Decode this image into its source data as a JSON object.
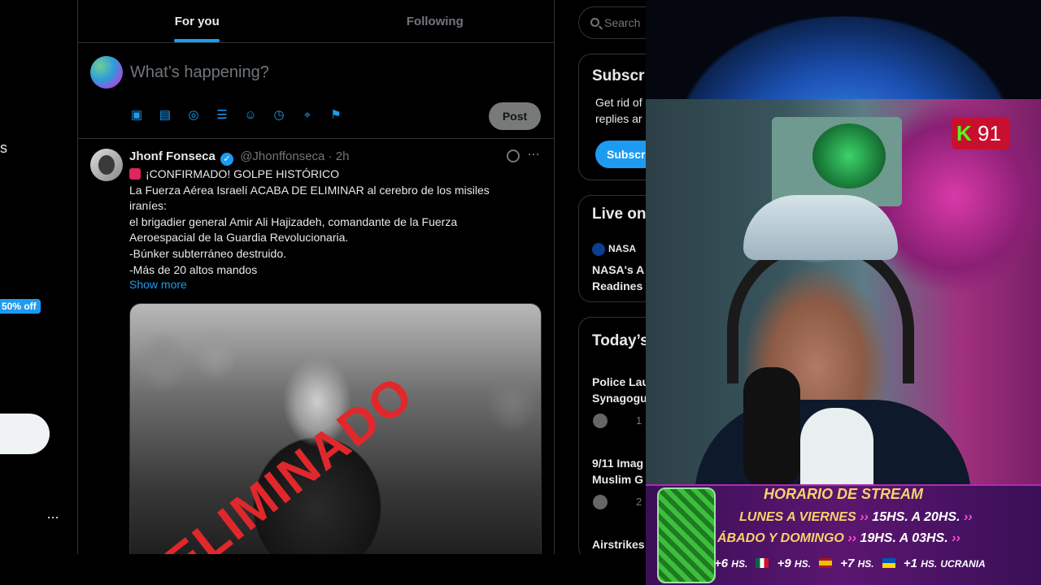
{
  "left_nav": {
    "partial_label": "s",
    "promo_badge": "50% off",
    "more_icon": "ellipsis-icon",
    "more_glyph": "···"
  },
  "timeline": {
    "tabs": [
      {
        "label": "For you",
        "active": true
      },
      {
        "label": "Following",
        "active": false
      }
    ],
    "compose": {
      "placeholder": "What’s happening?",
      "tool_icons": [
        "image-icon",
        "gif-icon",
        "grok-icon",
        "poll-icon",
        "emoji-icon",
        "schedule-icon",
        "location-icon",
        "flag-icon"
      ],
      "post_label": "Post"
    },
    "tweet": {
      "name": "Jhonf Fonseca",
      "verified": true,
      "handle": "@Jhonffonseca",
      "time": "· 2h",
      "lines": [
        "¡CONFIRMADO! GOLPE HISTÓRICO",
        "La Fuerza Aérea Israelí ACABA DE ELIMINAR al cerebro de los misiles",
        "iraníes:",
        "el brigadier general Amir Ali Hajizadeh, comandante de la Fuerza",
        "Aeroespacial de la Guardia Revolucionaria.",
        "-Búnker subterráneo destruido.",
        "-Más de 20 altos mandos"
      ],
      "show_more": "Show more",
      "image_stamp": "ELIMINADO"
    }
  },
  "right_sidebar": {
    "search_placeholder": "Search",
    "subscribe_card": {
      "title": "Subscr",
      "text_line1": "Get rid of",
      "text_line2": "replies ar",
      "button": "Subscr"
    },
    "live_card": {
      "title": "Live on",
      "source": "NASA",
      "line1": "NASA's A",
      "line2": "Readines"
    },
    "news_card": {
      "title": "Today’s",
      "items": [
        {
          "line1": "Police Lau",
          "line2": "Synagogu",
          "count": "1"
        },
        {
          "line1": "9/11 Imag",
          "line2": "Muslim G",
          "count": "2"
        },
        {
          "line1": "Airstrikes",
          "line2": "",
          "count": ""
        }
      ]
    }
  },
  "stream_overlay": {
    "channel_badge": {
      "logo": "K",
      "number": "91"
    },
    "schedule": {
      "title": "HORARIO DE STREAM",
      "rows": [
        {
          "day": "LUNES A VIERNES",
          "start": "15HS.",
          "sep": "A",
          "end": "20HS."
        },
        {
          "day": "ÁBADO Y DOMINGO",
          "start": "19HS.",
          "sep": "A",
          "end": "03HS."
        }
      ],
      "timezones": [
        {
          "offset": "+6",
          "unit": "HS."
        },
        {
          "offset": "+9",
          "unit": "HS."
        },
        {
          "offset": "+7",
          "unit": "HS."
        },
        {
          "offset": "+1",
          "unit": "HS.",
          "label": "UCRANIA"
        }
      ],
      "edge_glyph": "1"
    }
  }
}
